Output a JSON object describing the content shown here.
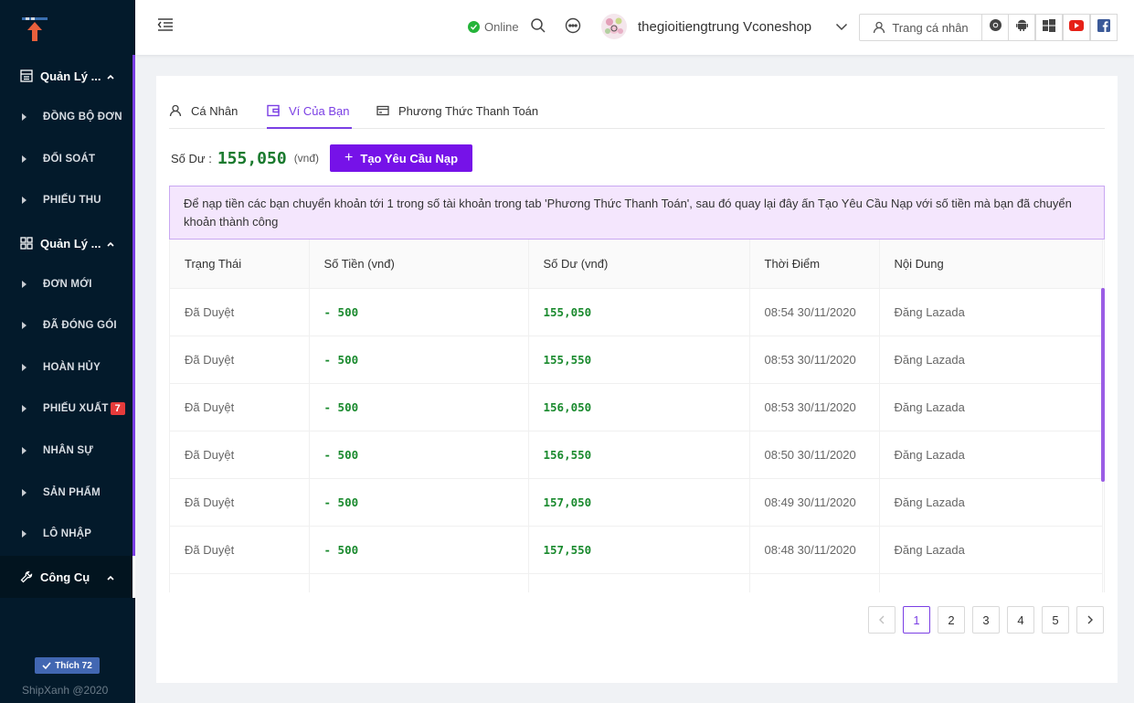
{
  "sidebar": {
    "groups": [
      {
        "label": "Quản Lý ...",
        "icon": "printer-icon"
      },
      {
        "label": "Quản Lý ...",
        "icon": "grid-icon"
      },
      {
        "label": "Công Cụ",
        "icon": "wrench-icon"
      }
    ],
    "items": [
      {
        "label": "ĐỒNG BỘ ĐƠN"
      },
      {
        "label": "ĐỐI SOÁT"
      },
      {
        "label": "PHIẾU THU"
      },
      {
        "label": "ĐƠN MỚI"
      },
      {
        "label": "ĐÃ ĐÓNG GÓI"
      },
      {
        "label": "HOÀN HỦY"
      },
      {
        "label": "PHIẾU XUẤT",
        "badge": "7"
      },
      {
        "label": "NHÂN SỰ"
      },
      {
        "label": "SẢN PHẨM"
      },
      {
        "label": "LÔ NHẬP"
      }
    ],
    "like_label": "Thích 72",
    "footer": "ShipXanh @2020"
  },
  "header": {
    "status": "Online",
    "username": "thegioitiengtrung Vconeshop",
    "profile_label": "Trang cá nhân",
    "apps": [
      "chrome-icon",
      "android-icon",
      "windows-icon",
      "youtube-icon",
      "facebook-icon"
    ]
  },
  "tabs": [
    {
      "label": "Cá Nhân"
    },
    {
      "label": "Ví Của Bạn"
    },
    {
      "label": "Phương Thức Thanh Toán"
    }
  ],
  "balance": {
    "label": "Số Dư :",
    "value": "155,050",
    "unit": "(vnđ)",
    "deposit_label": "Tạo Yêu Cầu Nạp"
  },
  "alert_text": "Để nạp tiền các bạn chuyển khoản tới 1 trong số tài khoản trong tab 'Phương Thức Thanh Toán', sau đó quay lại đây ấn Tạo Yêu Cầu Nạp với số tiền mà bạn đã chuyển khoản thành công",
  "table": {
    "headers": [
      "Trạng Thái",
      "Số Tiền (vnđ)",
      "Số Dư (vnđ)",
      "Thời Điểm",
      "Nội Dung"
    ],
    "rows": [
      {
        "status": "Đã Duyệt",
        "amount": "- 500",
        "balance": "155,050",
        "time": "08:54 30/11/2020",
        "content": "Đăng Lazada"
      },
      {
        "status": "Đã Duyệt",
        "amount": "- 500",
        "balance": "155,550",
        "time": "08:53 30/11/2020",
        "content": "Đăng Lazada"
      },
      {
        "status": "Đã Duyệt",
        "amount": "- 500",
        "balance": "156,050",
        "time": "08:53 30/11/2020",
        "content": "Đăng Lazada"
      },
      {
        "status": "Đã Duyệt",
        "amount": "- 500",
        "balance": "156,550",
        "time": "08:50 30/11/2020",
        "content": "Đăng Lazada"
      },
      {
        "status": "Đã Duyệt",
        "amount": "- 500",
        "balance": "157,050",
        "time": "08:49 30/11/2020",
        "content": "Đăng Lazada"
      },
      {
        "status": "Đã Duyệt",
        "amount": "- 500",
        "balance": "157,550",
        "time": "08:48 30/11/2020",
        "content": "Đăng Lazada"
      }
    ]
  },
  "pagination": {
    "pages": [
      "1",
      "2",
      "3",
      "4",
      "5"
    ],
    "current": "1"
  },
  "colors": {
    "accent": "#7b3fe4",
    "button": "#7612e8",
    "sidebar": "#031a2b",
    "money_green": "#1a7a2e",
    "online_green": "#25b43a"
  }
}
